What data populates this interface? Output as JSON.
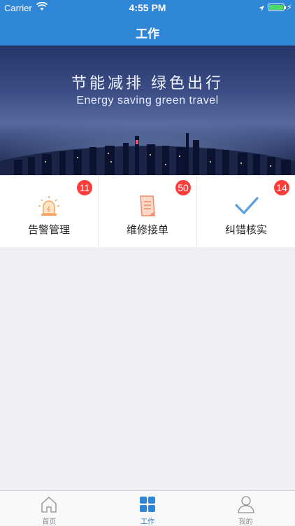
{
  "status_bar": {
    "carrier": "Carrier",
    "time": "4:55 PM"
  },
  "nav": {
    "title": "工作"
  },
  "banner": {
    "slogan_cn": "节能减排   绿色出行",
    "slogan_en": "Energy saving green travel"
  },
  "modules": [
    {
      "label": "告警管理",
      "badge": "11",
      "icon": "alarm-light-icon"
    },
    {
      "label": "维修接单",
      "badge": "50",
      "icon": "document-icon"
    },
    {
      "label": "纠错核实",
      "badge": "14",
      "icon": "checkmark-icon"
    }
  ],
  "tabbar": {
    "items": [
      {
        "label": "首页",
        "icon": "home-icon"
      },
      {
        "label": "工作",
        "icon": "grid-icon",
        "active": true
      },
      {
        "label": "我的",
        "icon": "user-icon"
      }
    ]
  },
  "colors": {
    "primary": "#2f86d6",
    "badge": "#fc3d39",
    "icon_orange": "#f4a460",
    "icon_blue": "#5aa0de"
  }
}
